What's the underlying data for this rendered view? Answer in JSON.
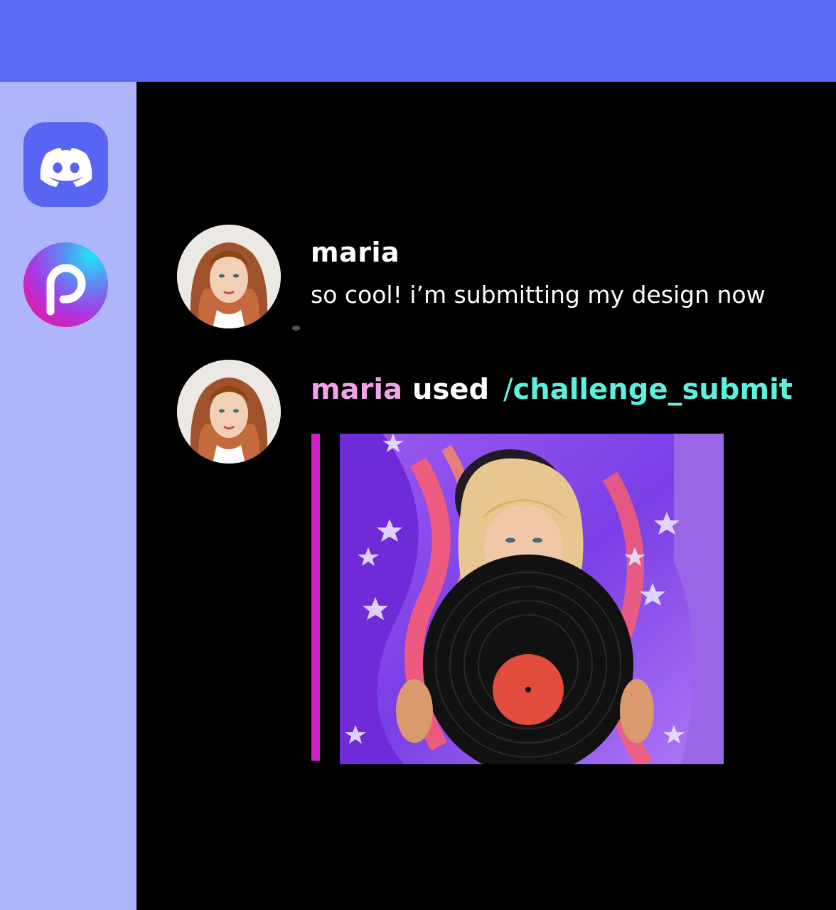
{
  "sidebar": {
    "apps": [
      {
        "name": "Discord",
        "icon": "discord-icon",
        "color": "#5865f2"
      },
      {
        "name": "Picsart",
        "icon": "picsart-icon",
        "glyph": "p"
      }
    ]
  },
  "chat": {
    "message": {
      "username": "maria",
      "text": "so cool! i’m submitting my design now"
    },
    "command": {
      "username": "maria",
      "verb": "used",
      "slash": "/",
      "name": "challenge_submit"
    }
  },
  "colors": {
    "topbar": "#5a69f2",
    "sidebar": "#aeb5fb",
    "main": "#000000",
    "username_highlight": "#f2a3e6",
    "command_color": "#5ef0df",
    "embed_bar": "#d020c8"
  }
}
